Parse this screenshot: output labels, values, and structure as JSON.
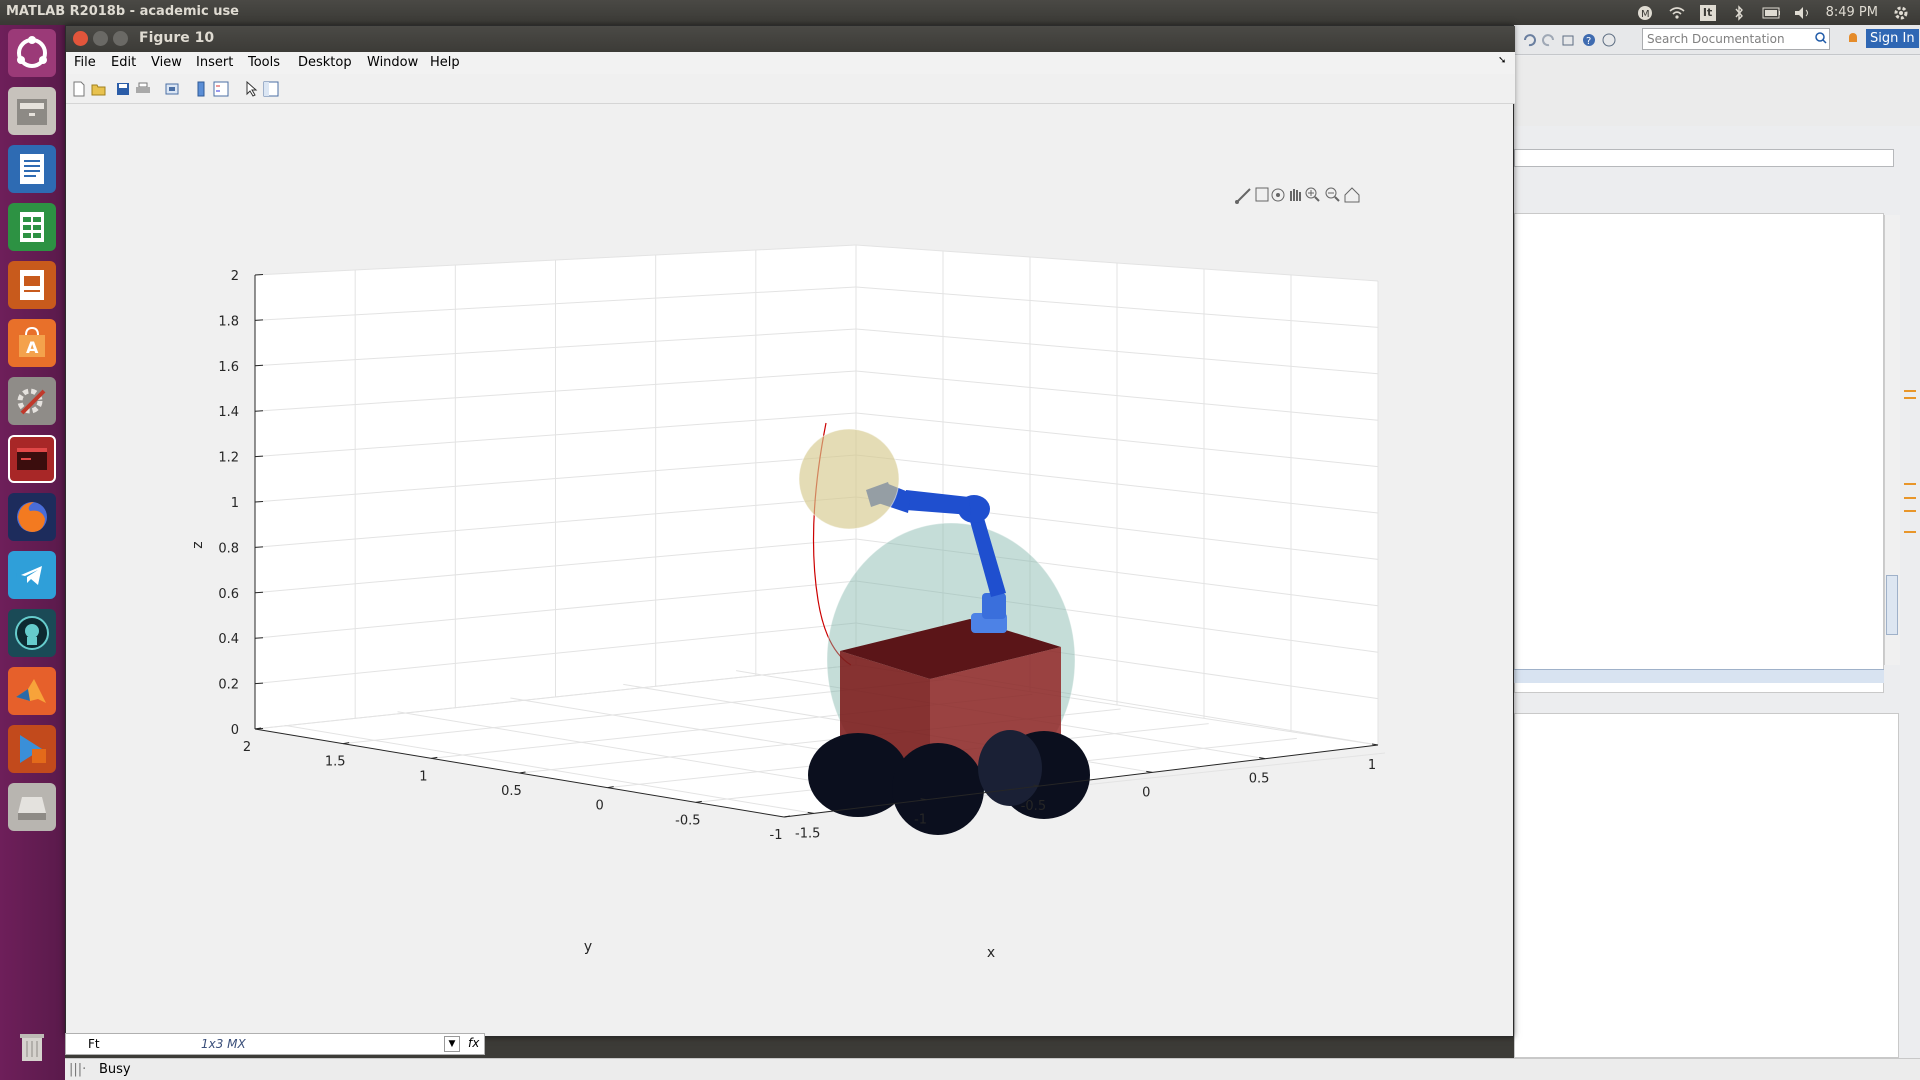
{
  "topbar": {
    "title": "MATLAB R2018b - academic use",
    "clock": "8:49 PM",
    "lang": "It"
  },
  "figure": {
    "title": "Figure 10",
    "menu": [
      "File",
      "Edit",
      "View",
      "Insert",
      "Tools",
      "Desktop",
      "Window",
      "Help"
    ]
  },
  "desktop": {
    "search_placeholder": "Search Documentation",
    "signin": "Sign In"
  },
  "workspace": {
    "var_name": "Ft",
    "var_value": "1x3 MX"
  },
  "status": {
    "text": "Busy"
  },
  "chart_data": {
    "type": "3d-scene",
    "xlabel": "x",
    "ylabel": "y",
    "zlabel": "z",
    "xticks": [
      "-1.5",
      "-1",
      "-0.5",
      "0",
      "0.5",
      "1"
    ],
    "yticks": [
      "2",
      "1.5",
      "1",
      "0.5",
      "0",
      "-0.5",
      "-1"
    ],
    "zticks": [
      "0",
      "0.2",
      "0.4",
      "0.6",
      "0.8",
      "1",
      "1.2",
      "1.4",
      "1.6",
      "1.8",
      "2"
    ],
    "xlim": [
      -1.5,
      1
    ],
    "ylim": [
      -1,
      2
    ],
    "zlim": [
      0,
      2
    ],
    "grid": true,
    "colors": {
      "arm": "#1f4fcf",
      "body": "#7a1414",
      "wheels": "#0b0f1e",
      "base_sphere": "#7fb3a8",
      "target_sphere": "#d6c98e",
      "trajectory": "#cc0000"
    }
  }
}
